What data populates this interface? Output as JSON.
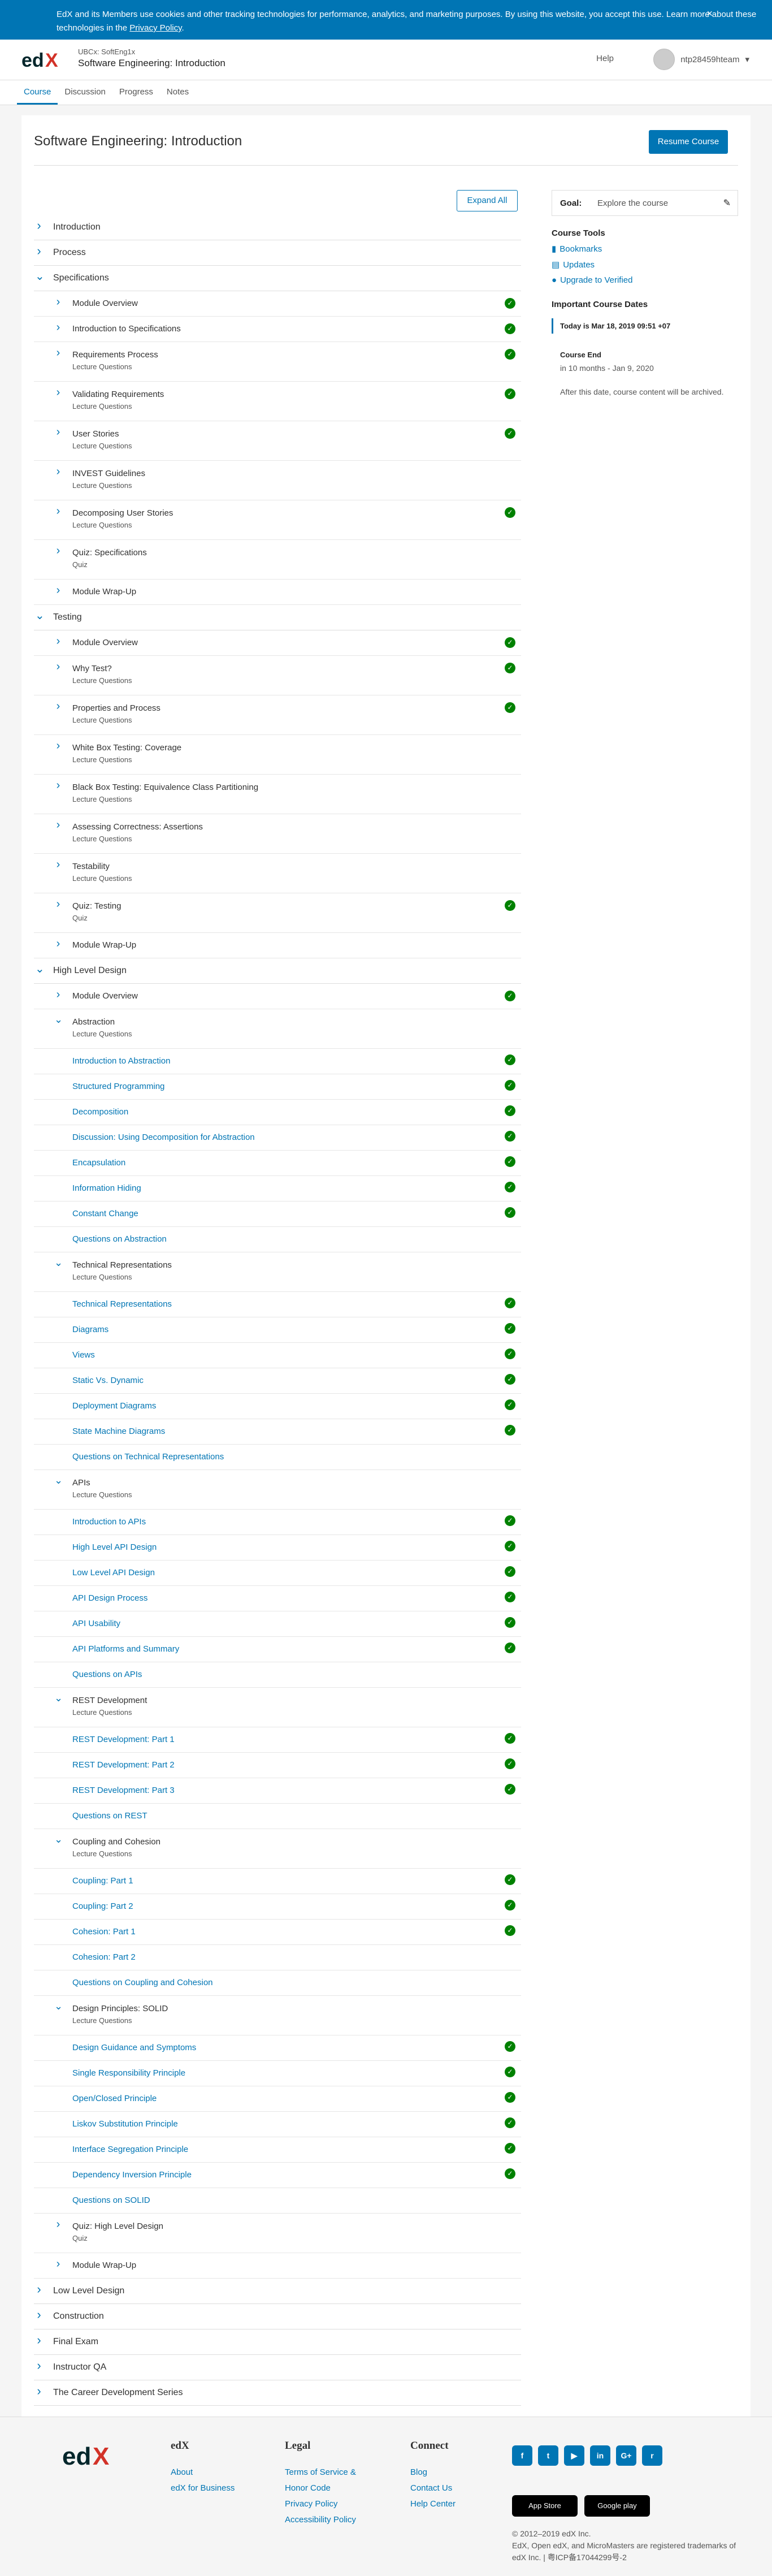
{
  "cookie": {
    "text": "EdX and its Members use cookies and other tracking technologies for performance, analytics, and marketing purposes. By using this website, you accept this use. Learn more about these technologies in the ",
    "link": "Privacy Policy",
    "close": "×"
  },
  "header": {
    "logo": "edX",
    "course_id": "UBCx: SoftEng1x",
    "course_name": "Software Engineering: Introduction",
    "help": "Help",
    "username": "ntp28459hteam",
    "caret": "▾"
  },
  "tabs": [
    "Course",
    "Discussion",
    "Progress",
    "Notes"
  ],
  "page": {
    "title": "Software Engineering: Introduction",
    "resume": "Resume Course",
    "expand_all": "Expand All"
  },
  "outline": [
    {
      "kind": "section",
      "title": "Introduction",
      "open": false
    },
    {
      "kind": "section",
      "title": "Process",
      "open": false
    },
    {
      "kind": "section",
      "title": "Specifications",
      "open": true
    },
    {
      "kind": "sub",
      "title": "Module Overview",
      "done": true
    },
    {
      "kind": "sub",
      "title": "Introduction to Specifications",
      "done": true
    },
    {
      "kind": "sub",
      "title": "Requirements Process",
      "sub": "Lecture Questions",
      "done": true
    },
    {
      "kind": "sub",
      "title": "Validating Requirements",
      "sub": "Lecture Questions",
      "done": true
    },
    {
      "kind": "sub",
      "title": "User Stories",
      "sub": "Lecture Questions",
      "done": true
    },
    {
      "kind": "sub",
      "title": "INVEST Guidelines",
      "sub": "Lecture Questions",
      "done": false
    },
    {
      "kind": "sub",
      "title": "Decomposing User Stories",
      "sub": "Lecture Questions",
      "done": true
    },
    {
      "kind": "sub",
      "title": "Quiz: Specifications",
      "sub": "Quiz",
      "done": false
    },
    {
      "kind": "sub",
      "title": "Module Wrap-Up",
      "done": false
    },
    {
      "kind": "section",
      "title": "Testing",
      "open": true
    },
    {
      "kind": "sub",
      "title": "Module Overview",
      "done": true
    },
    {
      "kind": "sub",
      "title": "Why Test?",
      "sub": "Lecture Questions",
      "done": true
    },
    {
      "kind": "sub",
      "title": "Properties and Process",
      "sub": "Lecture Questions",
      "done": true
    },
    {
      "kind": "sub",
      "title": "White Box Testing: Coverage",
      "sub": "Lecture Questions",
      "done": false
    },
    {
      "kind": "sub",
      "title": "Black Box Testing: Equivalence Class Partitioning",
      "sub": "Lecture Questions",
      "done": false
    },
    {
      "kind": "sub",
      "title": "Assessing Correctness: Assertions",
      "sub": "Lecture Questions",
      "done": false
    },
    {
      "kind": "sub",
      "title": "Testability",
      "sub": "Lecture Questions",
      "done": false
    },
    {
      "kind": "sub",
      "title": "Quiz: Testing",
      "sub": "Quiz",
      "done": true
    },
    {
      "kind": "sub",
      "title": "Module Wrap-Up",
      "done": false
    },
    {
      "kind": "section",
      "title": "High Level Design",
      "open": true
    },
    {
      "kind": "sub",
      "title": "Module Overview",
      "done": true
    },
    {
      "kind": "subopen",
      "title": "Abstraction",
      "sub": "Lecture Questions"
    },
    {
      "kind": "unit",
      "title": "Introduction to Abstraction",
      "done": true
    },
    {
      "kind": "unit",
      "title": "Structured Programming",
      "done": true
    },
    {
      "kind": "unit",
      "title": "Decomposition",
      "done": true
    },
    {
      "kind": "unit",
      "title": "Discussion: Using Decomposition for Abstraction",
      "done": true
    },
    {
      "kind": "unit",
      "title": "Encapsulation",
      "done": true
    },
    {
      "kind": "unit",
      "title": "Information Hiding",
      "done": true
    },
    {
      "kind": "unit",
      "title": "Constant Change",
      "done": true
    },
    {
      "kind": "unit",
      "title": "Questions on Abstraction",
      "done": false
    },
    {
      "kind": "subopen",
      "title": "Technical Representations",
      "sub": "Lecture Questions"
    },
    {
      "kind": "unit",
      "title": "Technical Representations",
      "done": true
    },
    {
      "kind": "unit",
      "title": "Diagrams",
      "done": true
    },
    {
      "kind": "unit",
      "title": "Views",
      "done": true
    },
    {
      "kind": "unit",
      "title": "Static Vs. Dynamic",
      "done": true
    },
    {
      "kind": "unit",
      "title": "Deployment Diagrams",
      "done": true
    },
    {
      "kind": "unit",
      "title": "State Machine Diagrams",
      "done": true
    },
    {
      "kind": "unit",
      "title": "Questions on Technical Representations",
      "done": false
    },
    {
      "kind": "subopen",
      "title": "APIs",
      "sub": "Lecture Questions"
    },
    {
      "kind": "unit",
      "title": "Introduction to APIs",
      "done": true
    },
    {
      "kind": "unit",
      "title": "High Level API Design",
      "done": true
    },
    {
      "kind": "unit",
      "title": "Low Level API Design",
      "done": true
    },
    {
      "kind": "unit",
      "title": "API Design Process",
      "done": true
    },
    {
      "kind": "unit",
      "title": "API Usability",
      "done": true
    },
    {
      "kind": "unit",
      "title": "API Platforms and Summary",
      "done": true
    },
    {
      "kind": "unit",
      "title": "Questions on APIs",
      "done": false
    },
    {
      "kind": "subopen",
      "title": "REST Development",
      "sub": "Lecture Questions"
    },
    {
      "kind": "unit",
      "title": "REST Development: Part 1",
      "done": true
    },
    {
      "kind": "unit",
      "title": "REST Development: Part 2",
      "done": true
    },
    {
      "kind": "unit",
      "title": "REST Development: Part 3",
      "done": true
    },
    {
      "kind": "unit",
      "title": "Questions on REST",
      "done": false
    },
    {
      "kind": "subopen",
      "title": "Coupling and Cohesion",
      "sub": "Lecture Questions"
    },
    {
      "kind": "unit",
      "title": "Coupling: Part 1",
      "done": true
    },
    {
      "kind": "unit",
      "title": "Coupling: Part 2",
      "done": true
    },
    {
      "kind": "unit",
      "title": "Cohesion: Part 1",
      "done": true
    },
    {
      "kind": "unit",
      "title": "Cohesion: Part 2",
      "done": false
    },
    {
      "kind": "unit",
      "title": "Questions on Coupling and Cohesion",
      "done": false
    },
    {
      "kind": "subopen",
      "title": "Design Principles: SOLID",
      "sub": "Lecture Questions"
    },
    {
      "kind": "unit",
      "title": "Design Guidance and Symptoms",
      "done": true
    },
    {
      "kind": "unit",
      "title": "Single Responsibility Principle",
      "done": true
    },
    {
      "kind": "unit",
      "title": "Open/Closed Principle",
      "done": true
    },
    {
      "kind": "unit",
      "title": "Liskov Substitution Principle",
      "done": true
    },
    {
      "kind": "unit",
      "title": "Interface Segregation Principle",
      "done": true
    },
    {
      "kind": "unit",
      "title": "Dependency Inversion Principle",
      "done": true
    },
    {
      "kind": "unit",
      "title": "Questions on SOLID",
      "done": false
    },
    {
      "kind": "sub",
      "title": "Quiz: High Level Design",
      "sub": "Quiz",
      "done": false
    },
    {
      "kind": "sub",
      "title": "Module Wrap-Up",
      "done": false
    },
    {
      "kind": "section",
      "title": "Low Level Design",
      "open": false
    },
    {
      "kind": "section",
      "title": "Construction",
      "open": false
    },
    {
      "kind": "section",
      "title": "Final Exam",
      "open": false
    },
    {
      "kind": "section",
      "title": "Instructor QA",
      "open": false
    },
    {
      "kind": "section",
      "title": "The Career Development Series",
      "open": false
    }
  ],
  "sidebar": {
    "goal_label": "Goal:",
    "goal_value": "Explore the course",
    "tools_heading": "Course Tools",
    "tools": [
      "Bookmarks",
      "Updates",
      "Upgrade to Verified"
    ],
    "dates_heading": "Important Course Dates",
    "today": "Today is Mar 18, 2019 09:51 +07",
    "end_heading": "Course End",
    "end_date": "in 10 months - Jan 9, 2020",
    "end_note": "After this date, course content will be archived."
  },
  "footer": {
    "logo": "edX",
    "col1": {
      "heading": "edX",
      "links": [
        "About",
        "edX for Business"
      ]
    },
    "col2": {
      "heading": "Legal",
      "links": [
        "Terms of Service & Honor Code",
        "Privacy Policy",
        "Accessibility Policy"
      ]
    },
    "col3": {
      "heading": "Connect",
      "links": [
        "Blog",
        "Contact Us",
        "Help Center"
      ]
    },
    "social": [
      "f",
      "t",
      "▶",
      "in",
      "G+",
      "r"
    ],
    "stores": [
      "App Store",
      "Google play"
    ],
    "copyright": "© 2012–2019 edX Inc.",
    "trademark": "EdX, Open edX, and MicroMasters are registered trademarks of edX Inc. | 粤ICP备17044299号-2"
  },
  "colors": {
    "accent": "#0075b4",
    "done": "#008100"
  }
}
